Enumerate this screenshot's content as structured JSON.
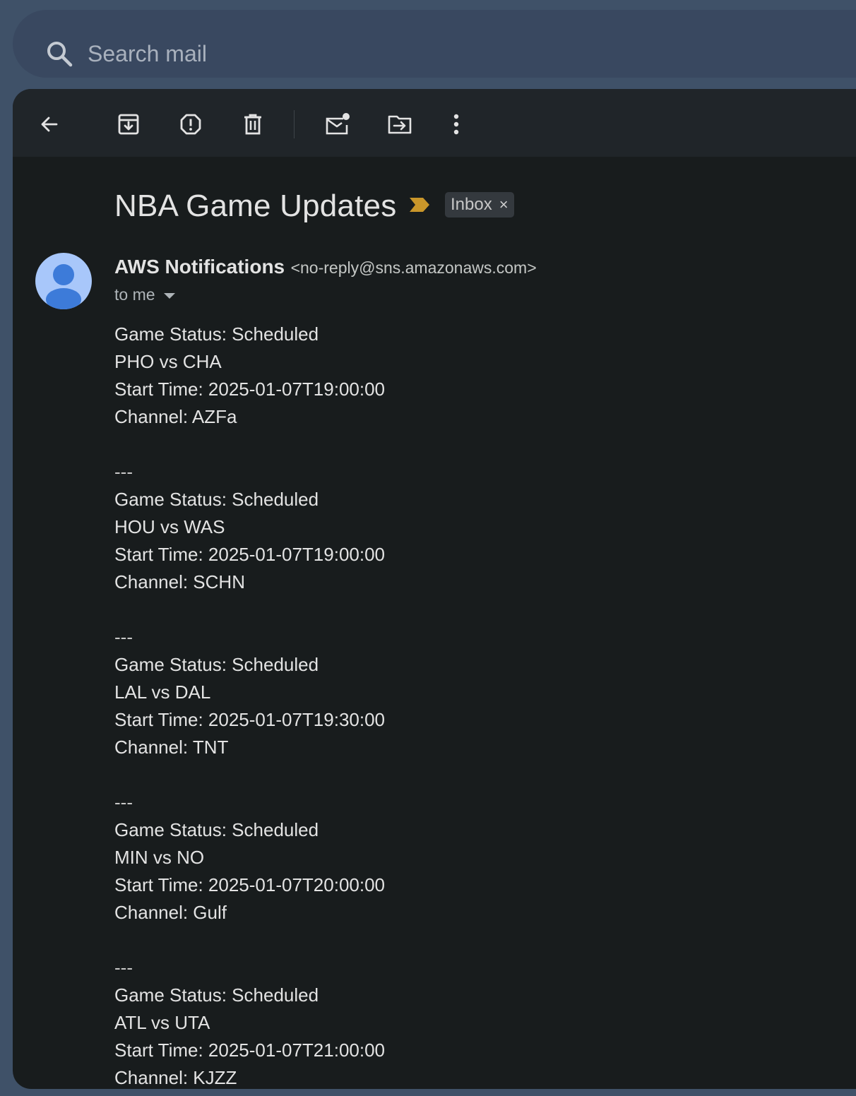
{
  "search": {
    "placeholder": "Search mail"
  },
  "toolbar": {
    "back": "back-arrow-icon",
    "archive": "archive-icon",
    "report_spam": "report-spam-icon",
    "delete": "trash-icon",
    "mark_unread": "mark-unread-icon",
    "move_to": "move-to-folder-icon",
    "more": "more-vert-icon"
  },
  "email": {
    "subject": "NBA Game Updates",
    "label": "Inbox",
    "label_remove": "×",
    "sender_name": "AWS Notifications",
    "sender_email": "<no-reply@sns.amazonaws.com>",
    "recipient": "to me",
    "body_lines": [
      "Game Status: Scheduled",
      "PHO vs CHA",
      "Start Time: 2025-01-07T19:00:00",
      "Channel: AZFa",
      "",
      "---",
      "Game Status: Scheduled",
      "HOU vs WAS",
      "Start Time: 2025-01-07T19:00:00",
      "Channel: SCHN",
      "",
      "---",
      "Game Status: Scheduled",
      "LAL vs DAL",
      "Start Time: 2025-01-07T19:30:00",
      "Channel: TNT",
      "",
      "---",
      "Game Status: Scheduled",
      "MIN vs NO",
      "Start Time: 2025-01-07T20:00:00",
      "Channel: Gulf",
      "",
      "---",
      "Game Status: Scheduled",
      "ATL vs UTA",
      "Start Time: 2025-01-07T21:00:00",
      "Channel: KJZZ"
    ]
  },
  "colors": {
    "page_bg": "#3f5168",
    "panel_bg": "#181c1d",
    "toolbar_bg": "#202529",
    "importance": "#c9962a",
    "avatar_bg": "#a8c7fa",
    "avatar_fg": "#3d7bd9"
  }
}
